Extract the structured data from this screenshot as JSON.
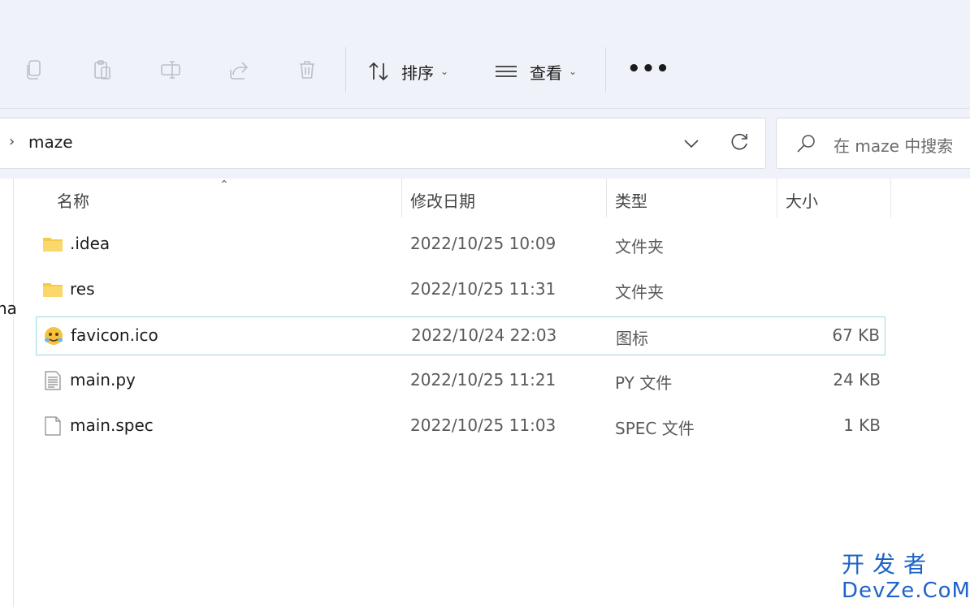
{
  "toolbar": {
    "sort_label": "排序",
    "view_label": "查看",
    "more_label": "•••"
  },
  "address": {
    "separator": "›",
    "path": "maze"
  },
  "search": {
    "placeholder": "在 maze 中搜索"
  },
  "nav": {
    "clipped_text": "na"
  },
  "columns": {
    "name": "名称",
    "date": "修改日期",
    "type": "类型",
    "size": "大小"
  },
  "files": [
    {
      "name": ".idea",
      "date": "2022/10/25 10:09",
      "type": "文件夹",
      "size": "",
      "icon": "folder-icon"
    },
    {
      "name": "res",
      "date": "2022/10/25 11:31",
      "type": "文件夹",
      "size": "",
      "icon": "folder-icon"
    },
    {
      "name": "favicon.ico",
      "date": "2022/10/24 22:03",
      "type": "图标",
      "size": "67 KB",
      "icon": "emoji-ico-icon"
    },
    {
      "name": "main.py",
      "date": "2022/10/25 11:21",
      "type": "PY 文件",
      "size": "24 KB",
      "icon": "text-file-icon"
    },
    {
      "name": "main.spec",
      "date": "2022/10/25 11:03",
      "type": "SPEC 文件",
      "size": "1 KB",
      "icon": "blank-file-icon"
    }
  ],
  "watermark": {
    "line1": "开发者",
    "line2": "DevZe.CoM"
  },
  "colors": {
    "toolbar_bg": "#eff2f8",
    "selection_border": "#99d8e4",
    "folder": "#f7c948",
    "watermark": "#1e63c8"
  }
}
